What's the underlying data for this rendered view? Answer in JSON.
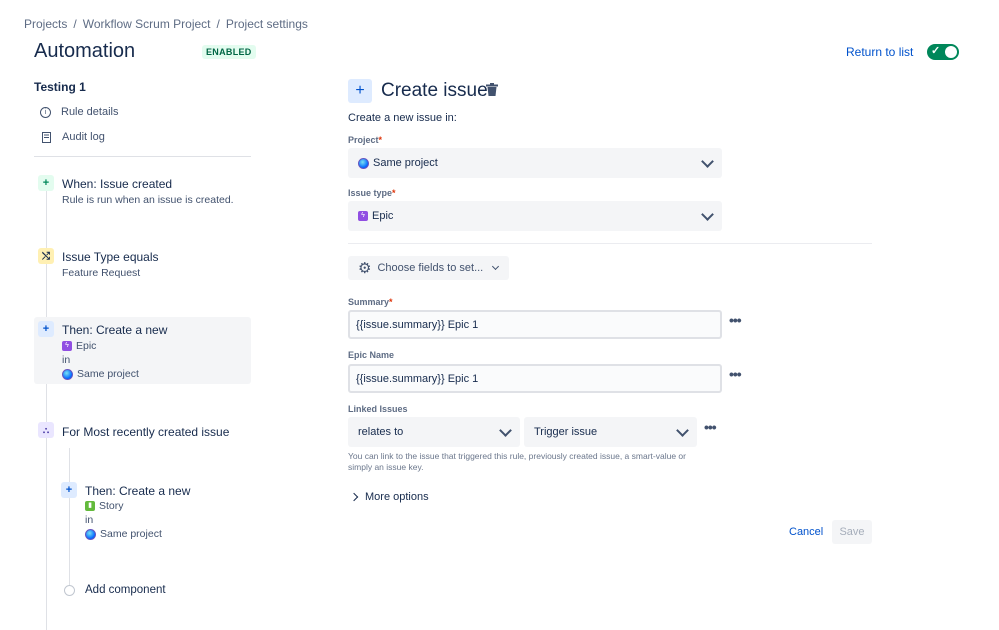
{
  "breadcrumb": [
    "Projects",
    "Workflow Scrum Project",
    "Project settings"
  ],
  "header": {
    "title": "Automation",
    "status_badge": "ENABLED",
    "return_link": "Return to list",
    "toggle_on": true
  },
  "sidebar": {
    "rule_name": "Testing 1",
    "links": [
      {
        "label": "Rule details",
        "icon": "info-icon"
      },
      {
        "label": "Audit log",
        "icon": "document-icon"
      }
    ],
    "steps": [
      {
        "title": "When: Issue created",
        "sub": "Rule is run when an issue is created.",
        "icon": "plus-icon"
      },
      {
        "title": "Issue Type equals",
        "sub": "Feature Request",
        "icon": "shuffle-icon"
      },
      {
        "title": "Then: Create a new",
        "type": "Epic",
        "in": "in",
        "project": "Same project",
        "icon": "plus-icon"
      },
      {
        "title": "For Most recently created issue",
        "icon": "branch-icon"
      },
      {
        "title": "Then: Create a new",
        "type": "Story",
        "in": "in",
        "project": "Same project",
        "icon": "plus-icon"
      },
      {
        "title": "Add component",
        "icon": "circle-icon"
      }
    ]
  },
  "main": {
    "title": "Create issue",
    "intro": "Create a new issue in:",
    "project_label": "Project",
    "project_value": "Same project",
    "issue_type_label": "Issue type",
    "issue_type_value": "Epic",
    "choose_fields": "Choose fields to set...",
    "summary_label": "Summary",
    "summary_value": "{{issue.summary}} Epic 1",
    "epic_name_label": "Epic Name",
    "epic_name_value": "{{issue.summary}} Epic 1",
    "linked_issues_label": "Linked Issues",
    "link_type": "relates to",
    "link_target": "Trigger issue",
    "help_text": "You can link to the issue that triggered this rule, previously created issue, a smart-value or simply an issue key.",
    "more_options": "More options",
    "cancel": "Cancel",
    "save": "Save",
    "required_mark": "*",
    "more_glyph": "•••"
  },
  "colors": {
    "accent": "#0052CC",
    "enabled": "#00875A",
    "epic": "#904EE2",
    "story": "#63BA3C"
  }
}
